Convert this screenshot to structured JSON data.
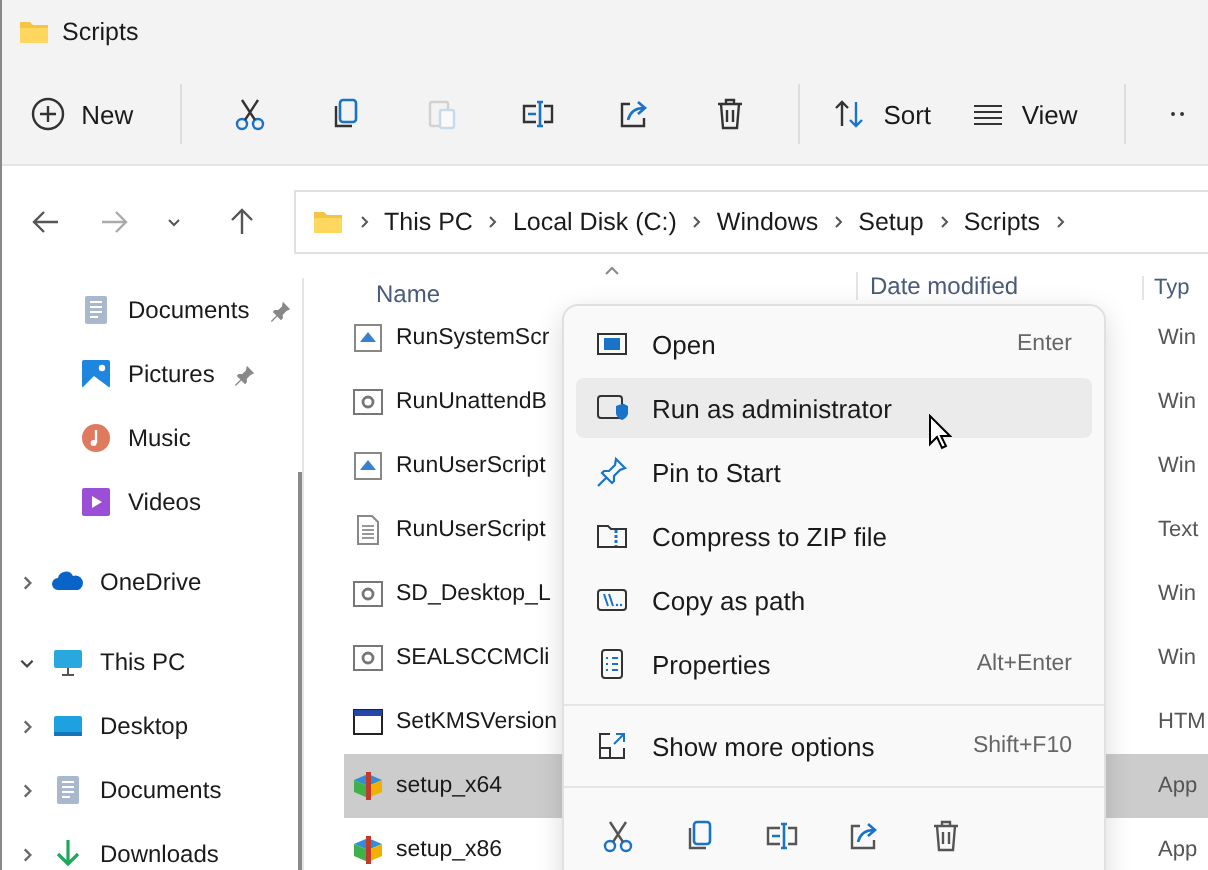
{
  "window": {
    "title": "Scripts"
  },
  "toolbar": {
    "items": [
      {
        "kind": "new",
        "label": "New",
        "disabled": false
      },
      {
        "kind": "cut",
        "disabled": false
      },
      {
        "kind": "copy",
        "disabled": false
      },
      {
        "kind": "paste",
        "disabled": true
      },
      {
        "kind": "rename",
        "disabled": false
      },
      {
        "kind": "share",
        "disabled": false
      },
      {
        "kind": "delete",
        "disabled": false
      },
      {
        "kind": "sort",
        "label": "Sort",
        "disabled": false
      },
      {
        "kind": "view",
        "label": "View",
        "disabled": false
      },
      {
        "kind": "more",
        "disabled": false
      }
    ]
  },
  "navigation": {
    "back_disabled": false,
    "forward_disabled": true
  },
  "address_bar": {
    "path": [
      "This PC",
      "Local Disk (C:)",
      "Windows",
      "Setup",
      "Scripts"
    ]
  },
  "sidebar": {
    "items": [
      {
        "label": "Documents",
        "kind": "documents",
        "pinned": true
      },
      {
        "label": "Pictures",
        "kind": "pictures",
        "pinned": true
      },
      {
        "label": "Music",
        "kind": "music"
      },
      {
        "label": "Videos",
        "kind": "videos"
      },
      {
        "label": "OneDrive",
        "kind": "cloud",
        "expanded": false
      },
      {
        "label": "This PC",
        "kind": "pc",
        "expanded": true,
        "children": [
          {
            "label": "Desktop",
            "kind": "desktop",
            "expanded": false
          },
          {
            "label": "Documents",
            "kind": "documents",
            "expanded": false
          },
          {
            "label": "Downloads",
            "kind": "downloads",
            "expanded": false
          }
        ]
      }
    ]
  },
  "file_list": {
    "columns": [
      "Name",
      "Date modified",
      "Typ"
    ],
    "rows": [
      {
        "name": "RunSystemScr",
        "kind": "script",
        "type": "Win",
        "selected": false
      },
      {
        "name": "RunUnattendB",
        "kind": "exe",
        "type": "Win",
        "selected": false
      },
      {
        "name": "RunUserScript",
        "kind": "script",
        "type": "Win",
        "selected": false
      },
      {
        "name": "RunUserScript",
        "kind": "text",
        "type": "Text",
        "selected": false
      },
      {
        "name": "SD_Desktop_L",
        "kind": "exe",
        "type": "Win",
        "selected": false
      },
      {
        "name": "SEALSCCMCli",
        "kind": "exe",
        "type": "Win",
        "selected": false
      },
      {
        "name": "SetKMSVersion",
        "kind": "html",
        "type": "HTM",
        "selected": false
      },
      {
        "name": "setup_x64",
        "kind": "installer",
        "type": "App",
        "selected": true
      },
      {
        "name": "setup_x86",
        "kind": "installer",
        "type": "App",
        "selected": false
      }
    ]
  },
  "context_menu": {
    "items": [
      {
        "label": "Open",
        "shortcut": "Enter",
        "selected": false
      },
      {
        "label": "Run as administrator",
        "selected": true
      },
      {
        "label": "Pin to Start",
        "selected": false
      },
      {
        "label": "Compress to ZIP file",
        "selected": false
      },
      {
        "label": "Copy as path",
        "selected": false
      },
      {
        "label": "Properties",
        "shortcut": "Alt+Enter",
        "selected": false
      }
    ],
    "more": {
      "label": "Show more options",
      "shortcut": "Shift+F10"
    }
  }
}
